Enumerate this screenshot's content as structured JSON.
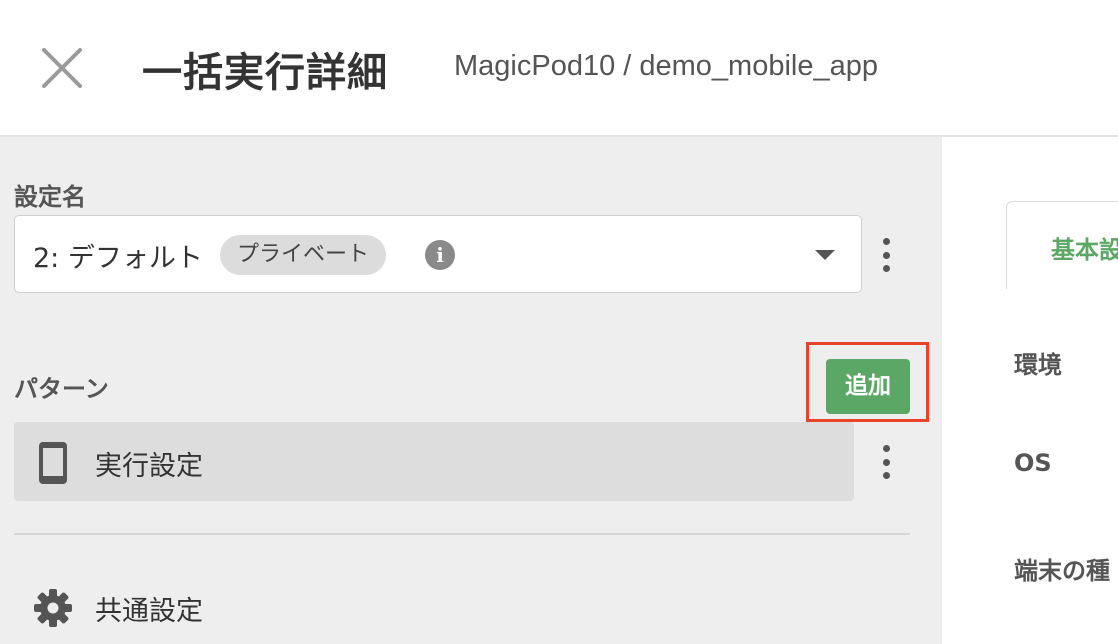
{
  "header": {
    "title": "一括実行詳細",
    "breadcrumb": "MagicPod10 / demo_mobile_app"
  },
  "settings": {
    "label": "設定名",
    "selected_value": "2: デフォルト",
    "badge": "プライベート",
    "info_glyph": "i"
  },
  "patterns": {
    "label": "パターン",
    "add_label": "追加",
    "items": [
      {
        "label": "実行設定",
        "icon": "mobile-phone-icon"
      }
    ]
  },
  "common": {
    "label": "共通設定",
    "icon": "gear-icon"
  },
  "right_panel": {
    "tab_label": "基本設",
    "fields": [
      "環境",
      "OS",
      "端末の種"
    ]
  },
  "colors": {
    "accent_green": "#5ba866",
    "highlight_red": "#e8442a",
    "panel_bg": "#eeeeee"
  }
}
